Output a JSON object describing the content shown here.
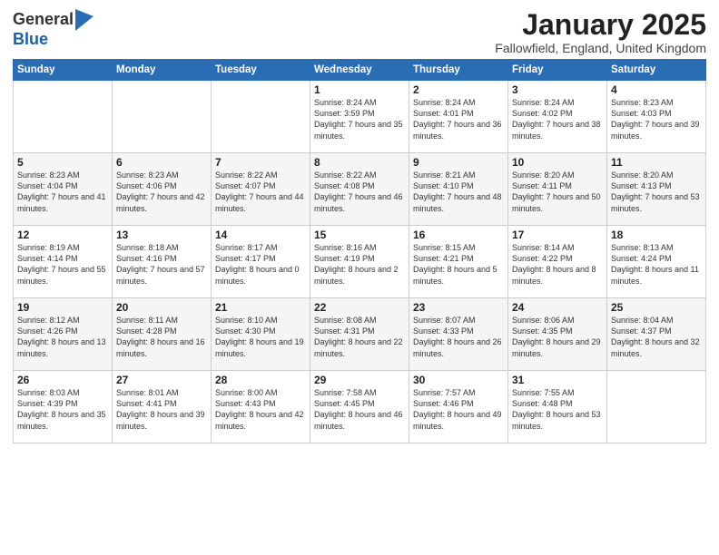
{
  "logo": {
    "general": "General",
    "blue": "Blue"
  },
  "title": "January 2025",
  "subtitle": "Fallowfield, England, United Kingdom",
  "days_of_week": [
    "Sunday",
    "Monday",
    "Tuesday",
    "Wednesday",
    "Thursday",
    "Friday",
    "Saturday"
  ],
  "weeks": [
    [
      {
        "day": "",
        "info": ""
      },
      {
        "day": "",
        "info": ""
      },
      {
        "day": "",
        "info": ""
      },
      {
        "day": "1",
        "info": "Sunrise: 8:24 AM\nSunset: 3:59 PM\nDaylight: 7 hours and 35 minutes."
      },
      {
        "day": "2",
        "info": "Sunrise: 8:24 AM\nSunset: 4:01 PM\nDaylight: 7 hours and 36 minutes."
      },
      {
        "day": "3",
        "info": "Sunrise: 8:24 AM\nSunset: 4:02 PM\nDaylight: 7 hours and 38 minutes."
      },
      {
        "day": "4",
        "info": "Sunrise: 8:23 AM\nSunset: 4:03 PM\nDaylight: 7 hours and 39 minutes."
      }
    ],
    [
      {
        "day": "5",
        "info": "Sunrise: 8:23 AM\nSunset: 4:04 PM\nDaylight: 7 hours and 41 minutes."
      },
      {
        "day": "6",
        "info": "Sunrise: 8:23 AM\nSunset: 4:06 PM\nDaylight: 7 hours and 42 minutes."
      },
      {
        "day": "7",
        "info": "Sunrise: 8:22 AM\nSunset: 4:07 PM\nDaylight: 7 hours and 44 minutes."
      },
      {
        "day": "8",
        "info": "Sunrise: 8:22 AM\nSunset: 4:08 PM\nDaylight: 7 hours and 46 minutes."
      },
      {
        "day": "9",
        "info": "Sunrise: 8:21 AM\nSunset: 4:10 PM\nDaylight: 7 hours and 48 minutes."
      },
      {
        "day": "10",
        "info": "Sunrise: 8:20 AM\nSunset: 4:11 PM\nDaylight: 7 hours and 50 minutes."
      },
      {
        "day": "11",
        "info": "Sunrise: 8:20 AM\nSunset: 4:13 PM\nDaylight: 7 hours and 53 minutes."
      }
    ],
    [
      {
        "day": "12",
        "info": "Sunrise: 8:19 AM\nSunset: 4:14 PM\nDaylight: 7 hours and 55 minutes."
      },
      {
        "day": "13",
        "info": "Sunrise: 8:18 AM\nSunset: 4:16 PM\nDaylight: 7 hours and 57 minutes."
      },
      {
        "day": "14",
        "info": "Sunrise: 8:17 AM\nSunset: 4:17 PM\nDaylight: 8 hours and 0 minutes."
      },
      {
        "day": "15",
        "info": "Sunrise: 8:16 AM\nSunset: 4:19 PM\nDaylight: 8 hours and 2 minutes."
      },
      {
        "day": "16",
        "info": "Sunrise: 8:15 AM\nSunset: 4:21 PM\nDaylight: 8 hours and 5 minutes."
      },
      {
        "day": "17",
        "info": "Sunrise: 8:14 AM\nSunset: 4:22 PM\nDaylight: 8 hours and 8 minutes."
      },
      {
        "day": "18",
        "info": "Sunrise: 8:13 AM\nSunset: 4:24 PM\nDaylight: 8 hours and 11 minutes."
      }
    ],
    [
      {
        "day": "19",
        "info": "Sunrise: 8:12 AM\nSunset: 4:26 PM\nDaylight: 8 hours and 13 minutes."
      },
      {
        "day": "20",
        "info": "Sunrise: 8:11 AM\nSunset: 4:28 PM\nDaylight: 8 hours and 16 minutes."
      },
      {
        "day": "21",
        "info": "Sunrise: 8:10 AM\nSunset: 4:30 PM\nDaylight: 8 hours and 19 minutes."
      },
      {
        "day": "22",
        "info": "Sunrise: 8:08 AM\nSunset: 4:31 PM\nDaylight: 8 hours and 22 minutes."
      },
      {
        "day": "23",
        "info": "Sunrise: 8:07 AM\nSunset: 4:33 PM\nDaylight: 8 hours and 26 minutes."
      },
      {
        "day": "24",
        "info": "Sunrise: 8:06 AM\nSunset: 4:35 PM\nDaylight: 8 hours and 29 minutes."
      },
      {
        "day": "25",
        "info": "Sunrise: 8:04 AM\nSunset: 4:37 PM\nDaylight: 8 hours and 32 minutes."
      }
    ],
    [
      {
        "day": "26",
        "info": "Sunrise: 8:03 AM\nSunset: 4:39 PM\nDaylight: 8 hours and 35 minutes."
      },
      {
        "day": "27",
        "info": "Sunrise: 8:01 AM\nSunset: 4:41 PM\nDaylight: 8 hours and 39 minutes."
      },
      {
        "day": "28",
        "info": "Sunrise: 8:00 AM\nSunset: 4:43 PM\nDaylight: 8 hours and 42 minutes."
      },
      {
        "day": "29",
        "info": "Sunrise: 7:58 AM\nSunset: 4:45 PM\nDaylight: 8 hours and 46 minutes."
      },
      {
        "day": "30",
        "info": "Sunrise: 7:57 AM\nSunset: 4:46 PM\nDaylight: 8 hours and 49 minutes."
      },
      {
        "day": "31",
        "info": "Sunrise: 7:55 AM\nSunset: 4:48 PM\nDaylight: 8 hours and 53 minutes."
      },
      {
        "day": "",
        "info": ""
      }
    ]
  ]
}
